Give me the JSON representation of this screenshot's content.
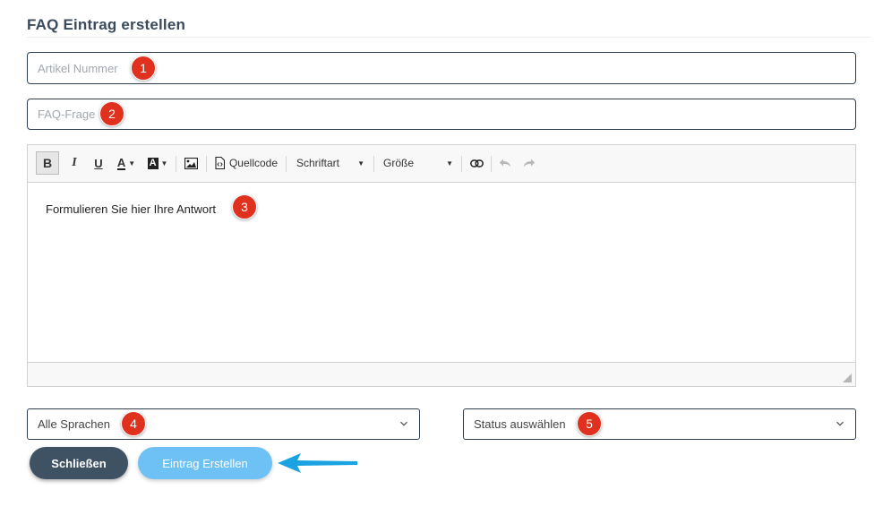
{
  "title": "FAQ Eintrag erstellen",
  "fields": {
    "article_number_placeholder": "Artikel Nummer",
    "question_placeholder": "FAQ-Frage"
  },
  "toolbar": {
    "bold": "B",
    "italic": "I",
    "underline": "U",
    "text_color": "A",
    "bg_color": "A",
    "source": "Quellcode",
    "font": "Schriftart",
    "size": "Größe"
  },
  "editor": {
    "content": "Formulieren Sie hier Ihre Antwort"
  },
  "selects": {
    "language": "Alle Sprachen",
    "status": "Status auswählen"
  },
  "buttons": {
    "close": "Schließen",
    "create": "Eintrag Erstellen"
  },
  "badges": [
    "1",
    "2",
    "3",
    "4",
    "5"
  ],
  "colors": {
    "badge": "#e0301e",
    "close_button": "#3f5264",
    "create_button": "#6ec1f4",
    "arrow": "#1aa3e0",
    "border": "#2f3f4f"
  }
}
